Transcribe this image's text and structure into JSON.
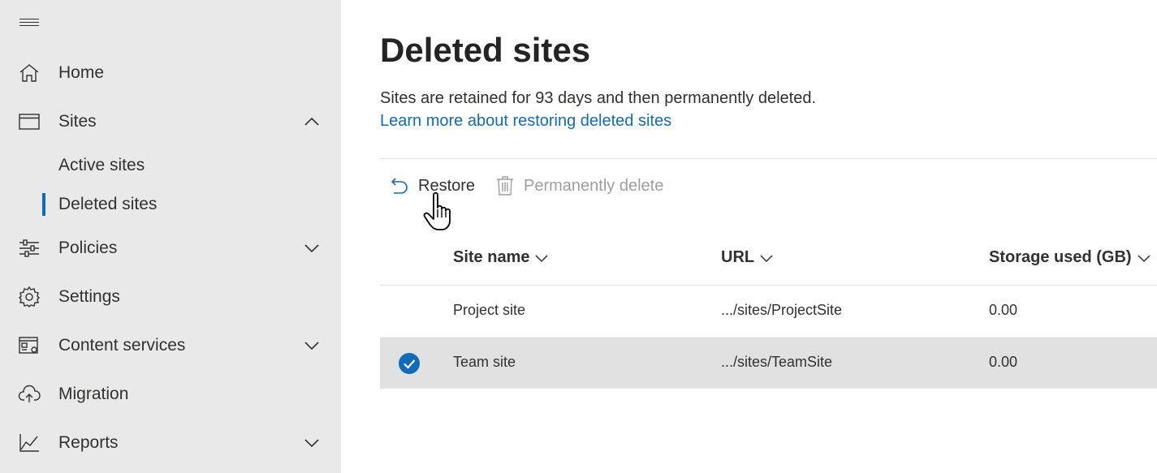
{
  "sidebar": {
    "items": [
      {
        "label": "Home",
        "icon": "home-icon"
      },
      {
        "label": "Sites",
        "icon": "browser-window-icon",
        "expanded": true
      },
      {
        "label": "Policies",
        "icon": "sliders-icon",
        "expanded": false
      },
      {
        "label": "Settings",
        "icon": "gear-icon"
      },
      {
        "label": "Content services",
        "icon": "content-services-icon",
        "expanded": false
      },
      {
        "label": "Migration",
        "icon": "cloud-upload-icon"
      },
      {
        "label": "Reports",
        "icon": "line-chart-icon",
        "expanded": false
      }
    ],
    "sites_subitems": [
      {
        "label": "Active sites",
        "selected": false
      },
      {
        "label": "Deleted sites",
        "selected": true
      }
    ],
    "accent_color": "#0f6cbd"
  },
  "main": {
    "title": "Deleted sites",
    "description": "Sites are retained for 93 days and then permanently deleted.",
    "learn_link": "Learn more about restoring deleted sites",
    "commands": {
      "restore": "Restore",
      "permanently_delete": "Permanently delete"
    },
    "table": {
      "columns": [
        "Site name",
        "URL",
        "Storage used (GB)"
      ],
      "rows": [
        {
          "name": "Project site",
          "url": ".../sites/ProjectSite",
          "storage": "0.00",
          "selected": false
        },
        {
          "name": "Team site",
          "url": ".../sites/TeamSite",
          "storage": "0.00",
          "selected": true
        }
      ]
    }
  }
}
